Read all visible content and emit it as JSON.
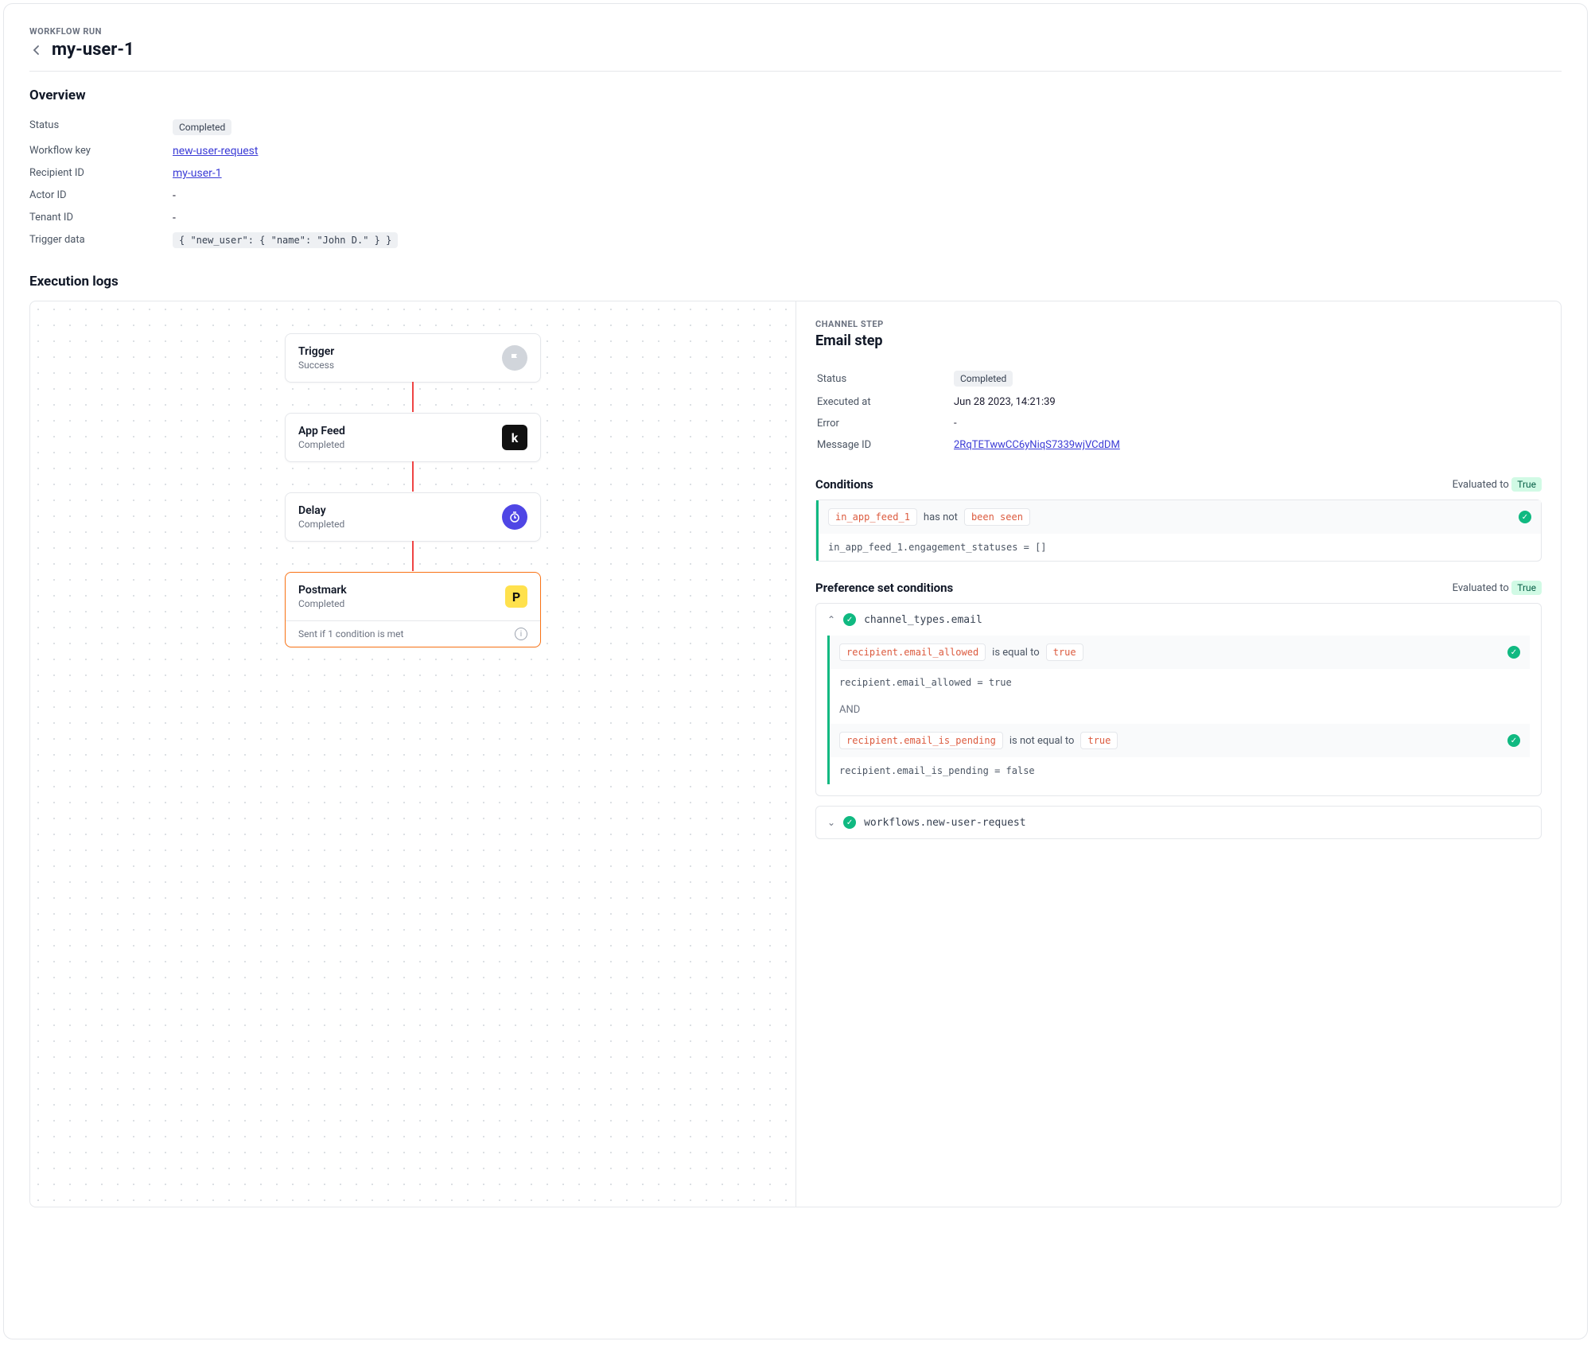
{
  "header": {
    "eyebrow": "WORKFLOW RUN",
    "title": "my-user-1"
  },
  "overview": {
    "title": "Overview",
    "rows": {
      "status_label": "Status",
      "status_value": "Completed",
      "workflow_key_label": "Workflow key",
      "workflow_key_value": "new-user-request",
      "recipient_label": "Recipient ID",
      "recipient_value": "my-user-1",
      "actor_label": "Actor ID",
      "actor_value": "-",
      "tenant_label": "Tenant ID",
      "tenant_value": "-",
      "trigger_label": "Trigger data",
      "trigger_value": "{ \"new_user\": { \"name\": \"John D.\" } }"
    }
  },
  "execution": {
    "title": "Execution logs",
    "nodes": [
      {
        "title": "Trigger",
        "subtitle": "Success",
        "icon": "flag"
      },
      {
        "title": "App Feed",
        "subtitle": "Completed",
        "icon": "k"
      },
      {
        "title": "Delay",
        "subtitle": "Completed",
        "icon": "timer"
      },
      {
        "title": "Postmark",
        "subtitle": "Completed",
        "icon": "p",
        "footer": "Sent if 1 condition is met",
        "selected": true
      }
    ]
  },
  "detail": {
    "eyebrow": "CHANNEL STEP",
    "title": "Email step",
    "rows": {
      "status_label": "Status",
      "status_value": "Completed",
      "executed_label": "Executed at",
      "executed_value": "Jun 28 2023, 14:21:39",
      "error_label": "Error",
      "error_value": "-",
      "message_label": "Message ID",
      "message_value": "2RqTETwwCC6yNiqS7339wjVCdDM"
    },
    "conditions": {
      "title": "Conditions",
      "evaluated_label": "Evaluated to",
      "evaluated_value": "True",
      "chip_var": "in_app_feed_1",
      "chip_op": "has not",
      "chip_val": "been seen",
      "result": "in_app_feed_1.engagement_statuses = []"
    },
    "preferences": {
      "title": "Preference set conditions",
      "evaluated_label": "Evaluated to",
      "evaluated_value": "True",
      "items": [
        {
          "expanded": true,
          "name": "channel_types.email",
          "conds": [
            {
              "var": "recipient.email_allowed",
              "op": "is equal to",
              "val": "true",
              "result": "recipient.email_allowed = true"
            },
            {
              "var": "recipient.email_is_pending",
              "op": "is not equal to",
              "val": "true",
              "result": "recipient.email_is_pending = false"
            }
          ],
          "joiner": "AND"
        },
        {
          "expanded": false,
          "name": "workflows.new-user-request"
        }
      ]
    }
  }
}
